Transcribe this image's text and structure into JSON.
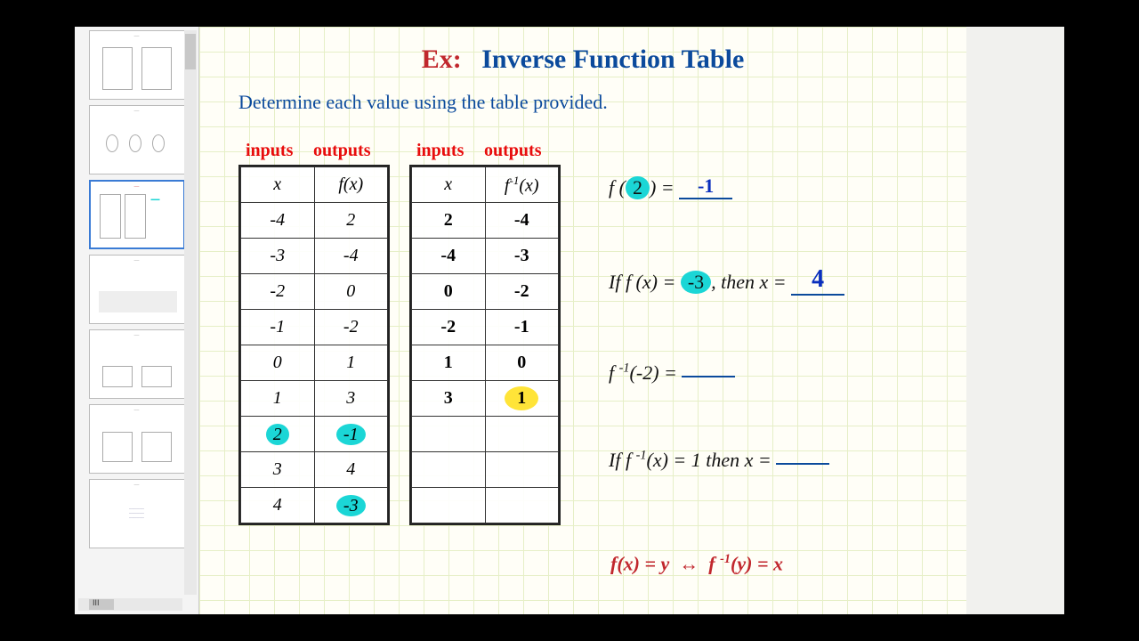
{
  "title": {
    "ex": "Ex:",
    "main": "Inverse Function Table"
  },
  "subtitle": "Determine each value using the table provided.",
  "labels": {
    "inputs": "inputs",
    "outputs": "outputs"
  },
  "table1": {
    "headers": {
      "x": "x",
      "fx": "f(x)"
    },
    "rows": [
      {
        "x": "-4",
        "fx": "2"
      },
      {
        "x": "-3",
        "fx": "-4"
      },
      {
        "x": "-2",
        "fx": "0"
      },
      {
        "x": "-1",
        "fx": "-2"
      },
      {
        "x": "0",
        "fx": "1"
      },
      {
        "x": "1",
        "fx": "3"
      },
      {
        "x": "2",
        "fx": "-1",
        "hl_x": true,
        "hl_fx": true
      },
      {
        "x": "3",
        "fx": "4"
      },
      {
        "x": "4",
        "fx": "-3",
        "hl_fx": true
      }
    ]
  },
  "table2": {
    "headers": {
      "x": "x",
      "finvx": "f⁻¹(x)"
    },
    "rows": [
      {
        "x": "2",
        "finvx": "-4"
      },
      {
        "x": "-4",
        "finvx": "-3"
      },
      {
        "x": "0",
        "finvx": "-2"
      },
      {
        "x": "-2",
        "finvx": "-1"
      },
      {
        "x": "1",
        "finvx": "0"
      },
      {
        "x": "3",
        "finvx": "1",
        "hl_finvx_yellow": true
      },
      {
        "x": "",
        "finvx": ""
      },
      {
        "x": "",
        "finvx": ""
      },
      {
        "x": "",
        "finvx": ""
      }
    ]
  },
  "eq1": {
    "lhs_a": "f (",
    "arg": "2",
    "lhs_b": ") = ",
    "ans": "-1"
  },
  "eq2": {
    "pre": "If f (x) = ",
    "val": "-3",
    "mid": ", then x = ",
    "ans": "4"
  },
  "eq3": {
    "text": "f ⁻¹(-2) = ",
    "ans": ""
  },
  "eq4": {
    "text": "If f ⁻¹(x) = 1 then x = ",
    "ans": ""
  },
  "eq5": "f(x) = y  ↔  f ⁻¹(y) = x",
  "scroll_label": "III"
}
